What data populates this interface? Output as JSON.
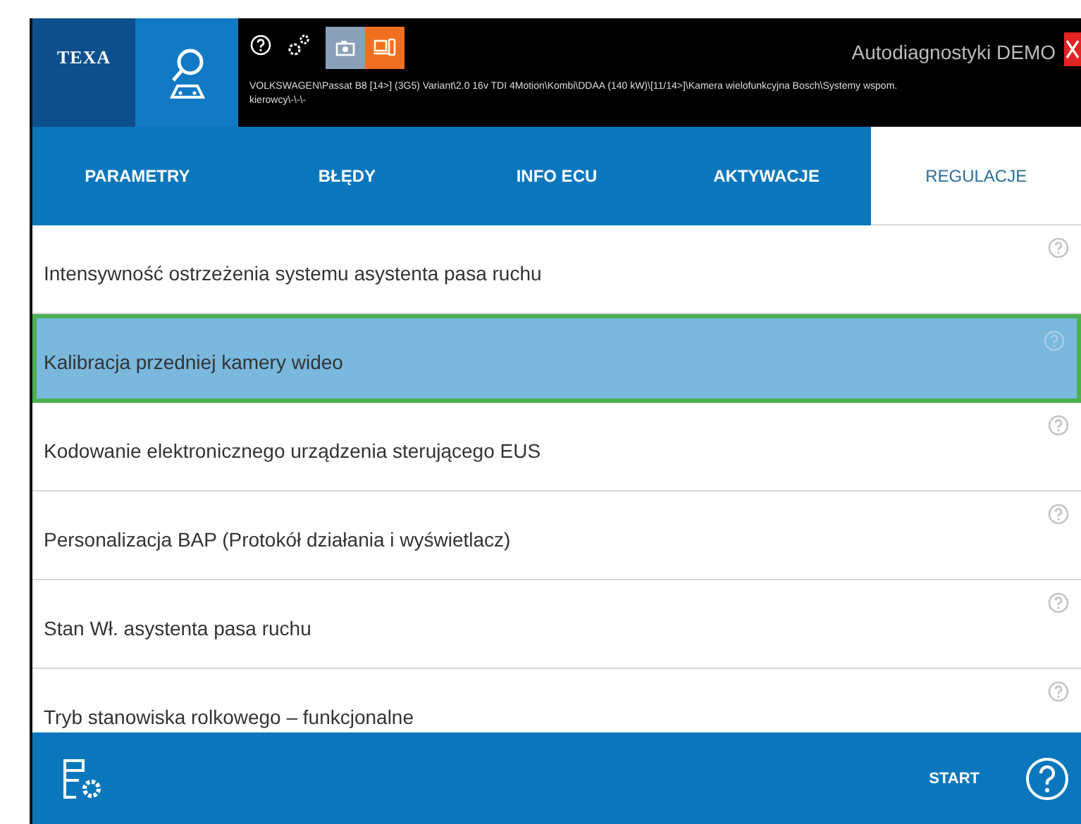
{
  "header": {
    "logo": "TEXA",
    "title": "Autodiagnostyki DEMO",
    "breadcrumb": "VOLKSWAGEN\\Passat B8 [14>] (3G5) Variant\\2.0 16v TDI 4Motion\\Kombi\\DDAA (140 kW)\\[11/14>]\\Kamera wielofunkcyjna Bosch\\Systemy wspom. kierowcy\\-\\-\\-"
  },
  "tabs": [
    {
      "label": "PARAMETRY",
      "selected": false
    },
    {
      "label": "BŁĘDY",
      "selected": false
    },
    {
      "label": "INFO ECU",
      "selected": false
    },
    {
      "label": "AKTYWACJE",
      "selected": false
    },
    {
      "label": "REGULACJE",
      "selected": true
    }
  ],
  "items": [
    {
      "label": "Intensywność ostrzeżenia systemu asystenta pasa ruchu",
      "selected": false
    },
    {
      "label": "Kalibracja przedniej kamery wideo",
      "selected": true
    },
    {
      "label": "Kodowanie elektronicznego urządzenia sterującego EUS",
      "selected": false
    },
    {
      "label": "Personalizacja BAP (Protokół działania i wyświetlacz)",
      "selected": false
    },
    {
      "label": "Stan Wł. asystenta pasa ruchu",
      "selected": false
    },
    {
      "label": "Tryb stanowiska rolkowego – funkcjonalne",
      "selected": false
    }
  ],
  "bottom_bar": {
    "start": "START"
  }
}
